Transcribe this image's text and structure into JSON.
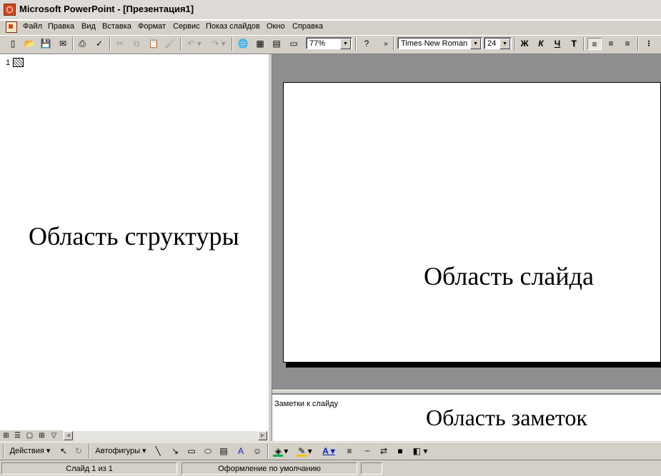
{
  "window": {
    "title": "Microsoft PowerPoint - [Презентация1]"
  },
  "menu": [
    "Файл",
    "Правка",
    "Вид",
    "Вставка",
    "Формат",
    "Сервис",
    "Показ слайдов",
    "Окно",
    "Справка"
  ],
  "toolbar": {
    "icons": [
      "new-icon",
      "open-icon",
      "save-icon",
      "email-icon",
      "print-icon",
      "spelling-icon",
      "cut-icon",
      "copy-icon",
      "paste-icon",
      "format-painter-icon",
      "undo-icon",
      "redo-icon",
      "hyperlink-icon",
      "tables-borders-icon",
      "insert-table-icon",
      "new-slide-icon",
      "help-icon",
      "more-buttons-icon"
    ],
    "zoom": "77%",
    "font": "Times New Roman",
    "font_size": "24",
    "bold": "Ж",
    "italic": "К",
    "underline": "Ч",
    "shadow": "Т"
  },
  "outline": {
    "slide_number": "1",
    "label": "Область структуры"
  },
  "slide": {
    "label": "Область слайда"
  },
  "notes": {
    "placeholder": "Заметки к слайду",
    "label": "Область заметок"
  },
  "drawing": {
    "actions": "Действия",
    "autoshapes": "Автофигуры"
  },
  "status": {
    "slide": "Слайд 1 из 1",
    "design": "Оформление по умолчанию",
    "extra": ""
  },
  "colors": {
    "fill": "#00b050",
    "line": "#f2c200",
    "font": "#1020c0"
  }
}
